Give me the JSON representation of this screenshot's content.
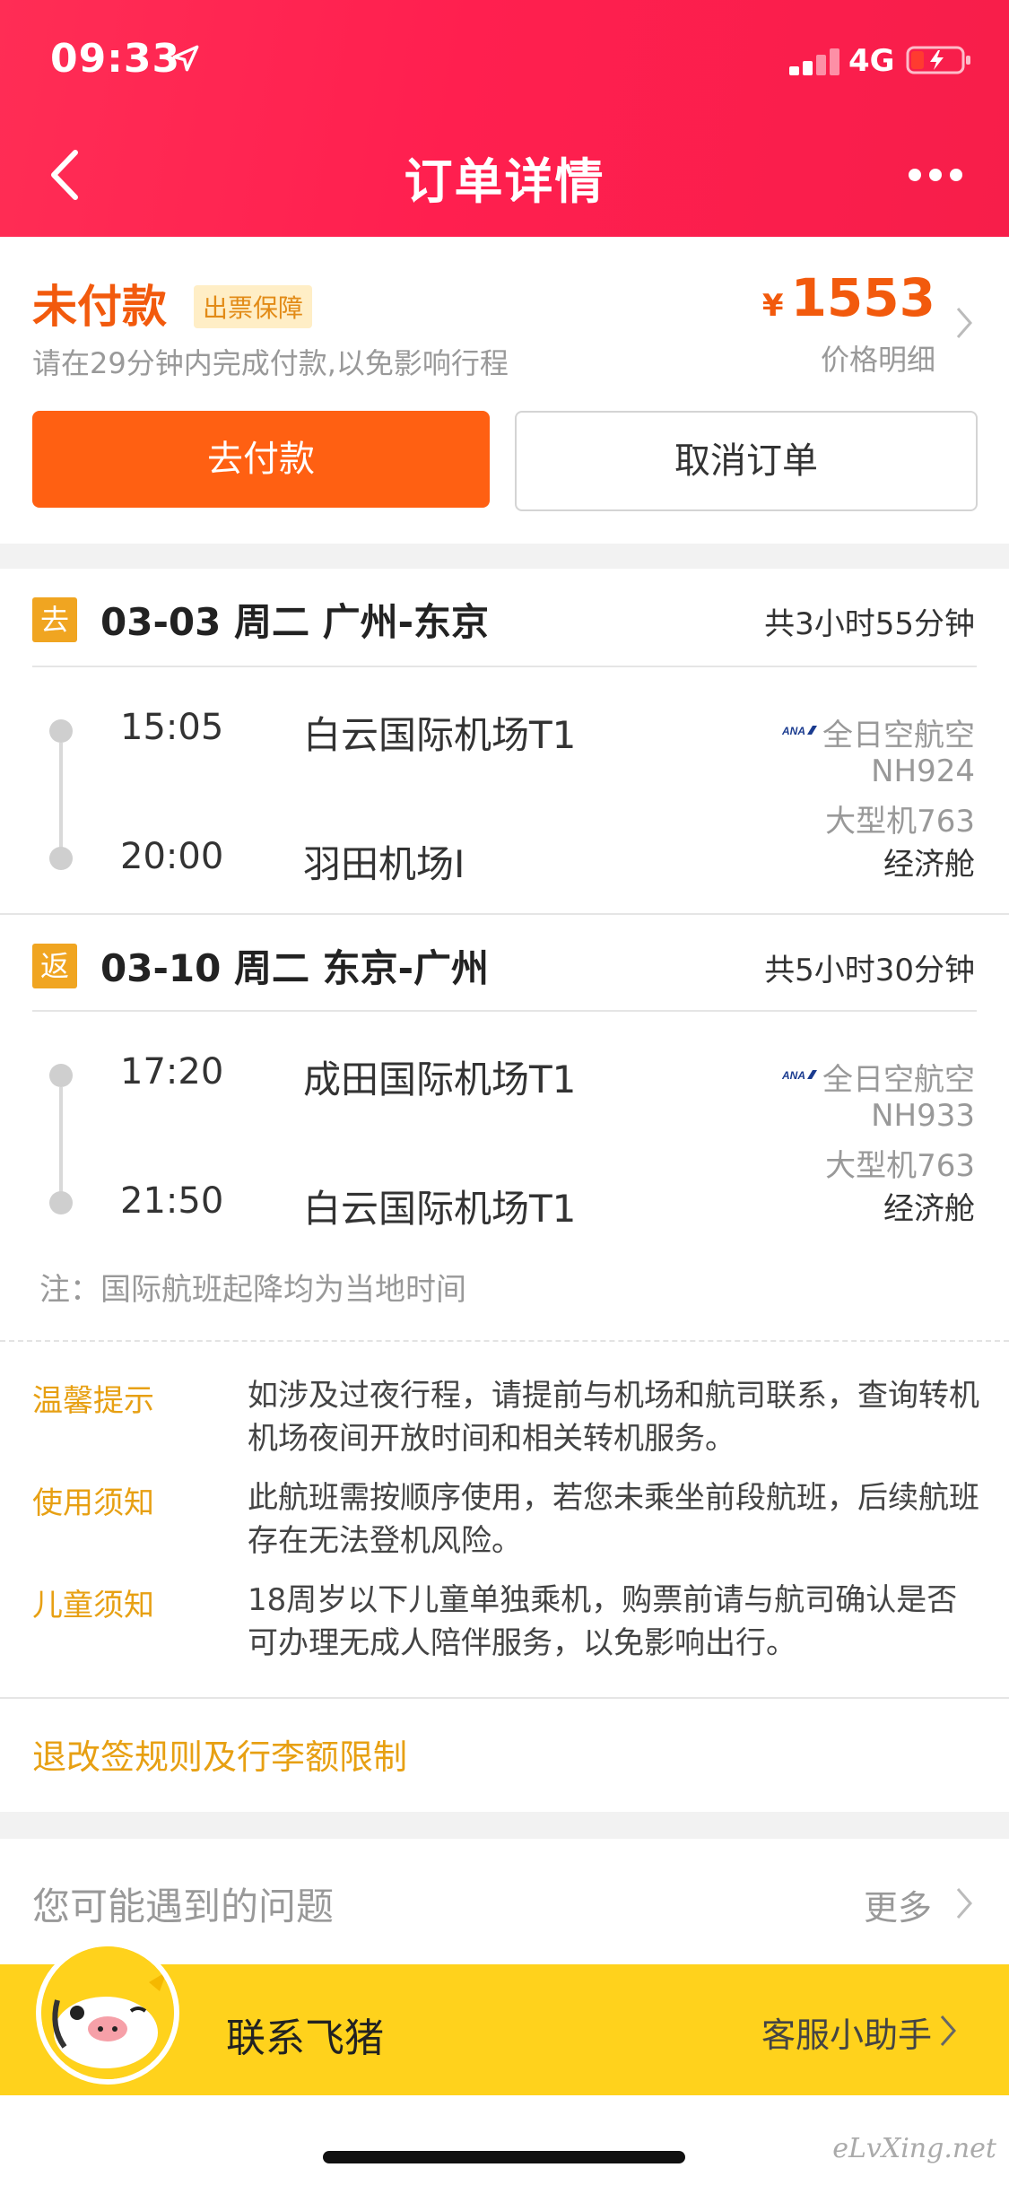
{
  "status_bar": {
    "time": "09:33",
    "network": "4G"
  },
  "nav": {
    "title": "订单详情"
  },
  "order": {
    "status": "未付款",
    "badge": "出票保障",
    "tip": "请在29分钟内完成付款,以免影响行程",
    "currency": "¥",
    "price": "1553",
    "price_detail": "价格明细",
    "pay_button": "去付款",
    "cancel_button": "取消订单"
  },
  "segments": [
    {
      "tag": "去",
      "title": "03-03 周二 广州-东京",
      "duration": "共3小时55分钟",
      "dep_time": "15:05",
      "dep_airport": "白云国际机场T1",
      "arr_time": "20:00",
      "arr_airport": "羽田机场I",
      "airline": "全日空航空",
      "flight_no": "NH924",
      "aircraft": "大型机763",
      "cabin": "经济舱"
    },
    {
      "tag": "返",
      "title": "03-10 周二 东京-广州",
      "duration": "共5小时30分钟",
      "dep_time": "17:20",
      "dep_airport": "成田国际机场T1",
      "arr_time": "21:50",
      "arr_airport": "白云国际机场T1",
      "airline": "全日空航空",
      "flight_no": "NH933",
      "aircraft": "大型机763",
      "cabin": "经济舱"
    }
  ],
  "note": "注：国际航班起降均为当地时间",
  "tips": [
    {
      "label": "温馨提示",
      "text": "如涉及过夜行程，请提前与机场和航司联系，查询转机机场夜间开放时间和相关转机服务。"
    },
    {
      "label": "使用须知",
      "text": "此航班需按顺序使用，若您未乘坐前段航班，后续航班存在无法登机风险。"
    },
    {
      "label": "儿童须知",
      "text": "18周岁以下儿童单独乘机，购票前请与航司确认是否可办理无成人陪伴服务，以免影响出行。"
    }
  ],
  "rules_link": "退改签规则及行李额限制",
  "faq": {
    "title": "您可能遇到的问题",
    "more": "更多"
  },
  "contact": {
    "title": "联系飞猪",
    "subtitle": "客服小助手"
  },
  "watermark": "eLvXing.net",
  "colors": {
    "header": "#ff2d55",
    "accent_orange": "#ff6012",
    "gold": "#e7a013",
    "contact_bar": "#ffd21c"
  }
}
